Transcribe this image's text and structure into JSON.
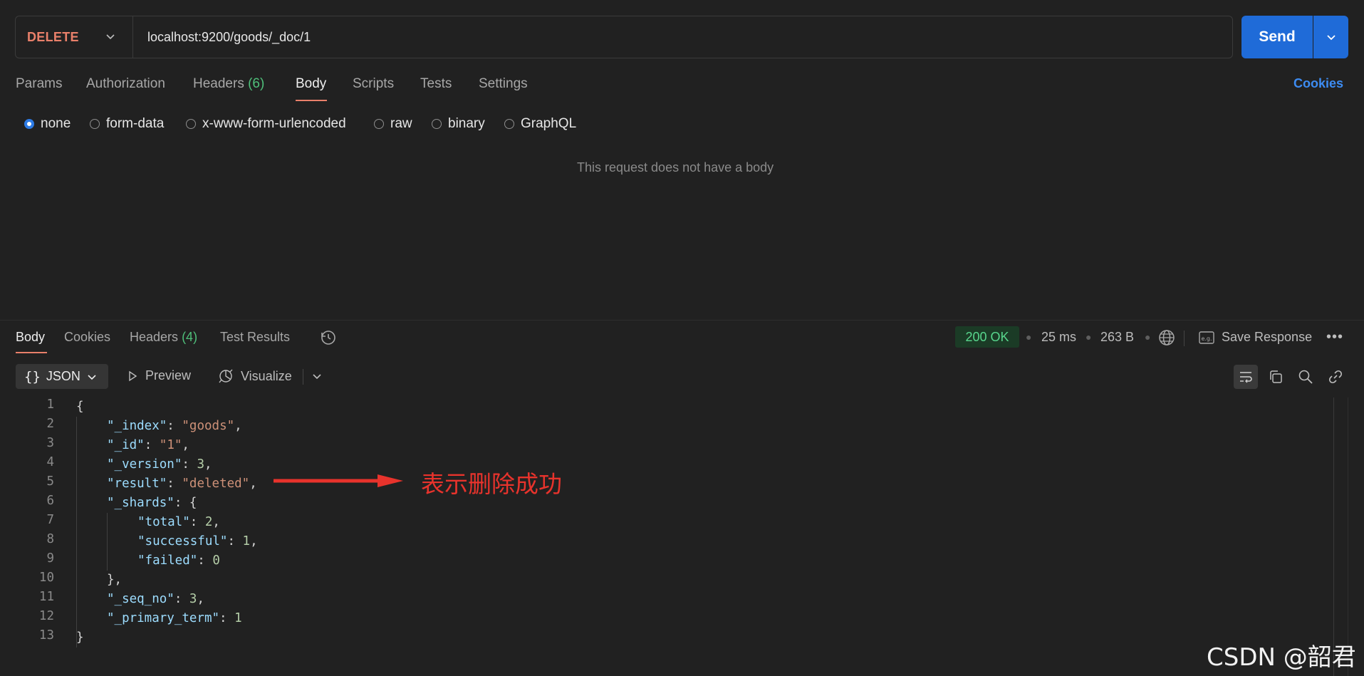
{
  "request": {
    "method": "DELETE",
    "url": "localhost:9200/goods/_doc/1",
    "send_label": "Send"
  },
  "request_tabs": [
    {
      "label": "Params"
    },
    {
      "label": "Authorization"
    },
    {
      "label": "Headers",
      "count": "(6)"
    },
    {
      "label": "Body",
      "active": true
    },
    {
      "label": "Scripts"
    },
    {
      "label": "Tests"
    },
    {
      "label": "Settings"
    }
  ],
  "cookies_link": "Cookies",
  "body_types": [
    {
      "label": "none",
      "selected": true
    },
    {
      "label": "form-data"
    },
    {
      "label": "x-www-form-urlencoded"
    },
    {
      "label": "raw"
    },
    {
      "label": "binary"
    },
    {
      "label": "GraphQL"
    }
  ],
  "no_body_message": "This request does not have a body",
  "response_tabs": [
    {
      "label": "Body",
      "active": true
    },
    {
      "label": "Cookies"
    },
    {
      "label": "Headers",
      "count": "(4)"
    },
    {
      "label": "Test Results"
    }
  ],
  "response_meta": {
    "status": "200 OK",
    "time": "25 ms",
    "size": "263 B",
    "save_label": "Save Response"
  },
  "format_bar": {
    "format": "JSON",
    "preview": "Preview",
    "visualize": "Visualize"
  },
  "code_lines": [
    {
      "n": "1",
      "text": "{"
    },
    {
      "n": "2",
      "text": "\"_index\": \"goods\","
    },
    {
      "n": "3",
      "text": "\"_id\": \"1\","
    },
    {
      "n": "4",
      "text": "\"_version\": 3,"
    },
    {
      "n": "5",
      "text": "\"result\": \"deleted\","
    },
    {
      "n": "6",
      "text": "\"_shards\": {"
    },
    {
      "n": "7",
      "text": "\"total\": 2,"
    },
    {
      "n": "8",
      "text": "\"successful\": 1,"
    },
    {
      "n": "9",
      "text": "\"failed\": 0"
    },
    {
      "n": "10",
      "text": "},"
    },
    {
      "n": "11",
      "text": "\"_seq_no\": 3,"
    },
    {
      "n": "12",
      "text": "\"_primary_term\": 1"
    },
    {
      "n": "13",
      "text": "}"
    }
  ],
  "annotation": "表示删除成功",
  "watermark": "CSDN @韶君",
  "colors": {
    "accent": "#1f6bd8",
    "method": "#e9806a",
    "status_ok": "#58d68d",
    "annotation": "#e8332c"
  }
}
